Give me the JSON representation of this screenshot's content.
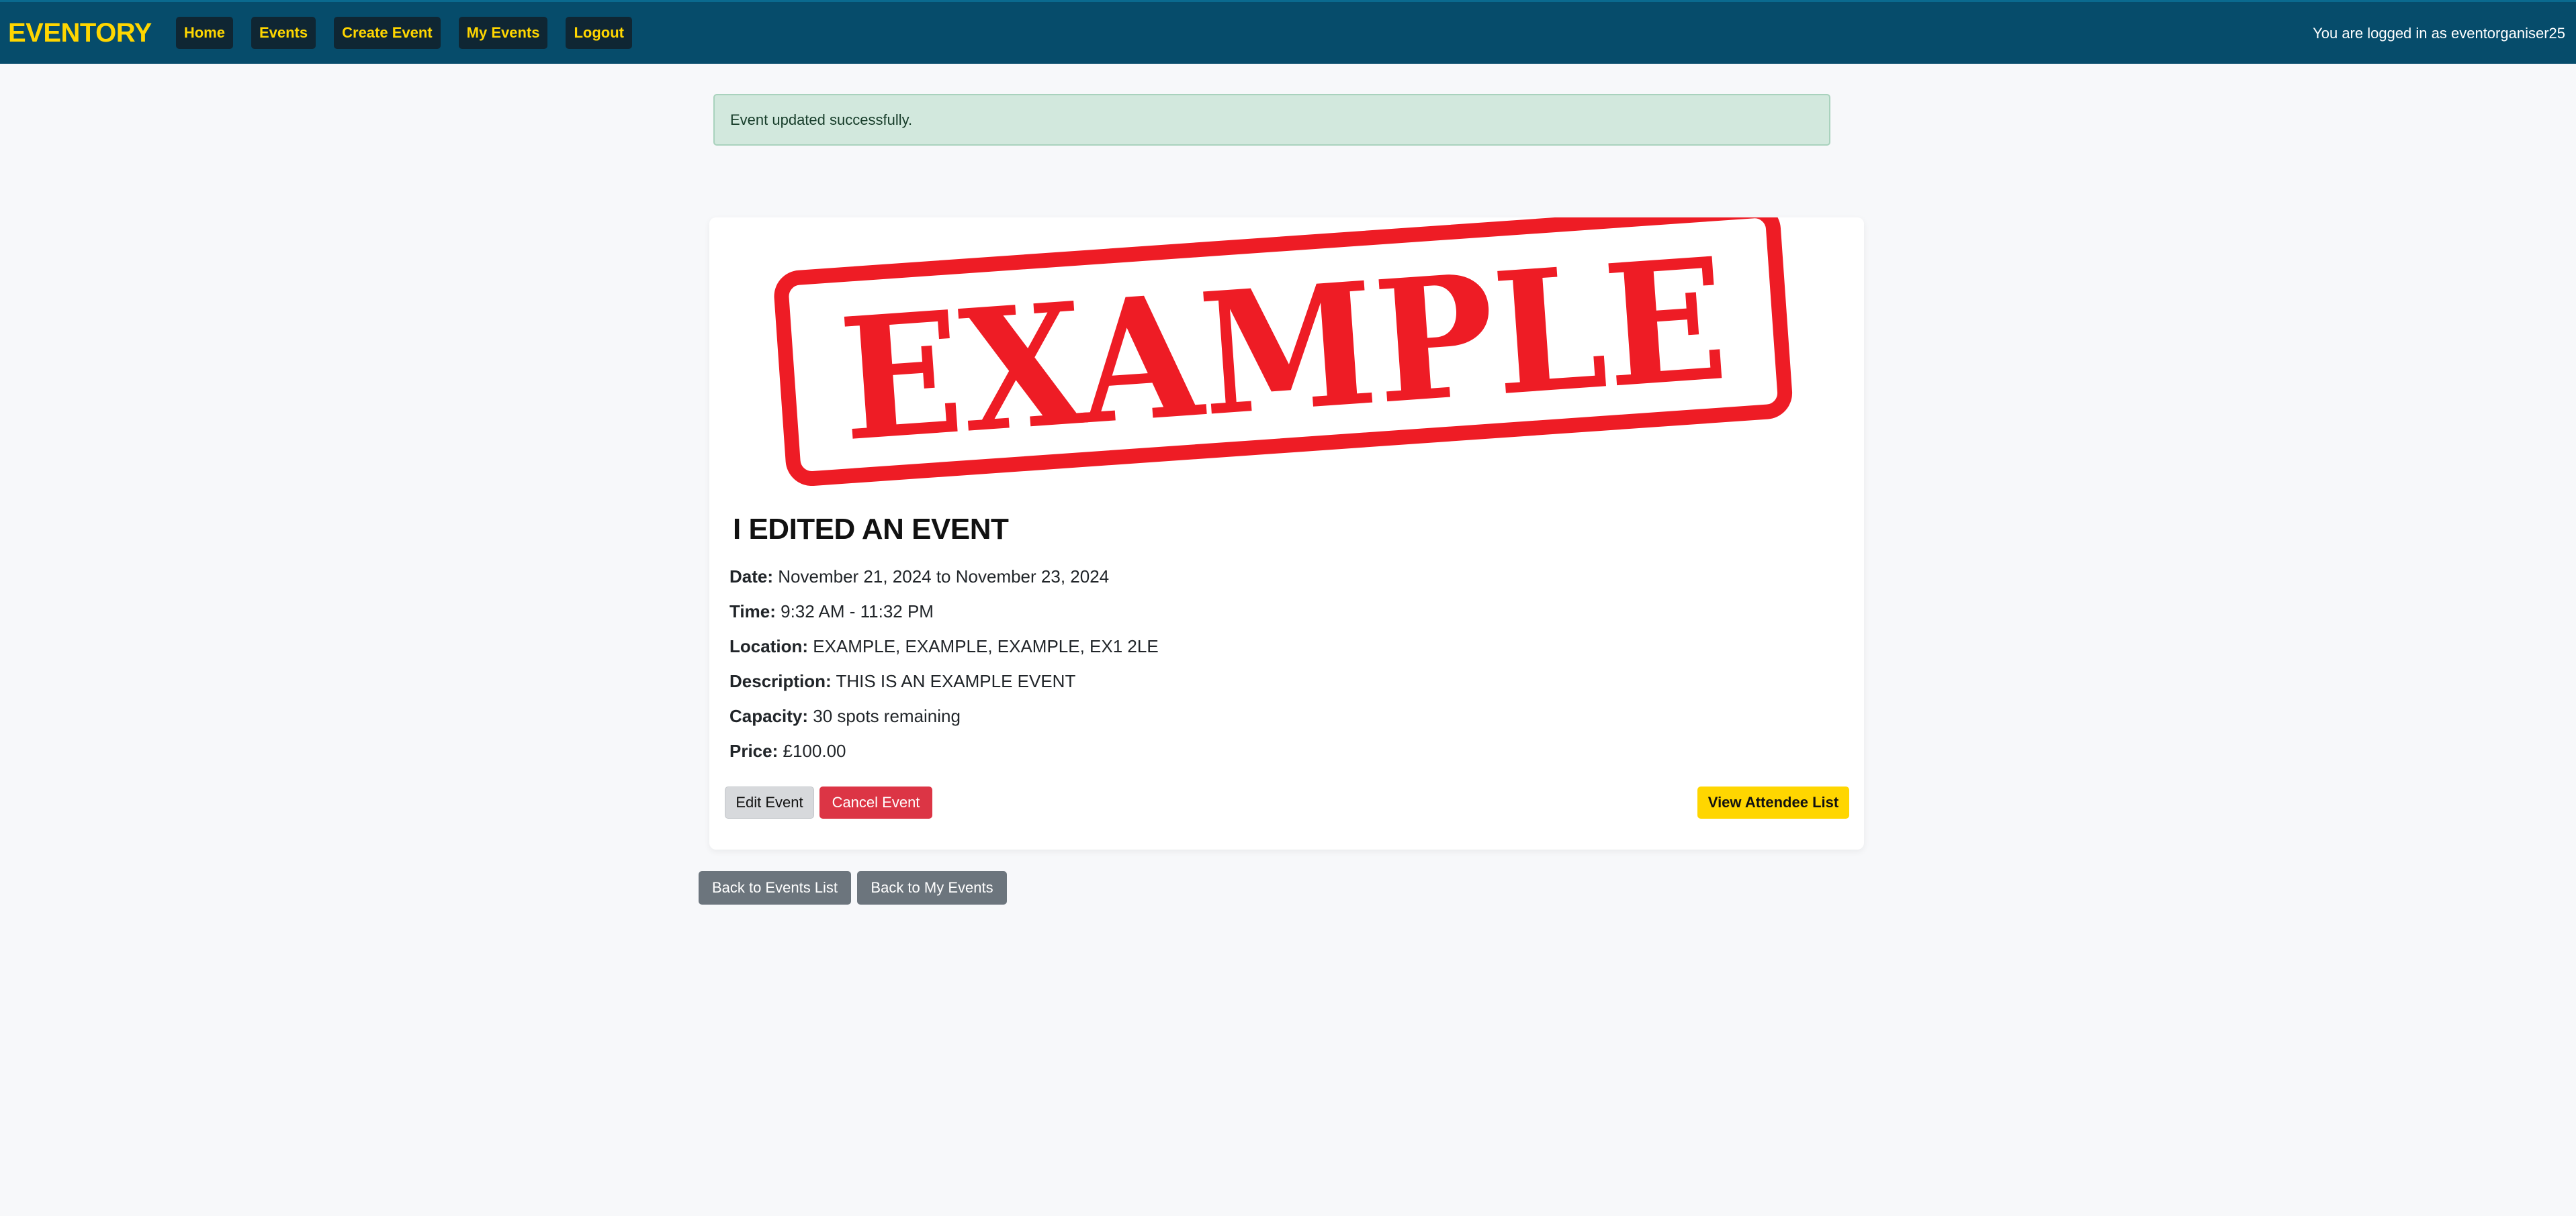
{
  "nav": {
    "brand": "EVENTORY",
    "items": [
      {
        "label": "Home"
      },
      {
        "label": "Events"
      },
      {
        "label": "Create Event"
      },
      {
        "label": "My Events"
      },
      {
        "label": "Logout"
      }
    ],
    "login_status": "You are logged in as eventorganiser25"
  },
  "alert": {
    "message": "Event updated successfully."
  },
  "event": {
    "image_text": "EXAMPLE",
    "title": "I EDITED AN EVENT",
    "date_label": "Date:",
    "date_value": "November 21, 2024 to November 23, 2024",
    "time_label": "Time:",
    "time_value": "9:32 AM - 11:32 PM",
    "location_label": "Location:",
    "location_value": "EXAMPLE, EXAMPLE, EXAMPLE, EX1 2LE",
    "description_label": "Description:",
    "description_value": "THIS IS AN EXAMPLE EVENT",
    "capacity_label": "Capacity:",
    "capacity_value": "30 spots remaining",
    "price_label": "Price:",
    "price_value": "£100.00"
  },
  "actions": {
    "edit": "Edit Event",
    "cancel": "Cancel Event",
    "attendees": "View Attendee List",
    "back_events": "Back to Events List",
    "back_my_events": "Back to My Events"
  },
  "colors": {
    "navbar": "#064c6b",
    "brand": "#ffd600",
    "danger": "#dc3545",
    "secondary": "#6c757d",
    "success_bg": "#d2e8dd",
    "stamp_red": "#ee1c25"
  }
}
